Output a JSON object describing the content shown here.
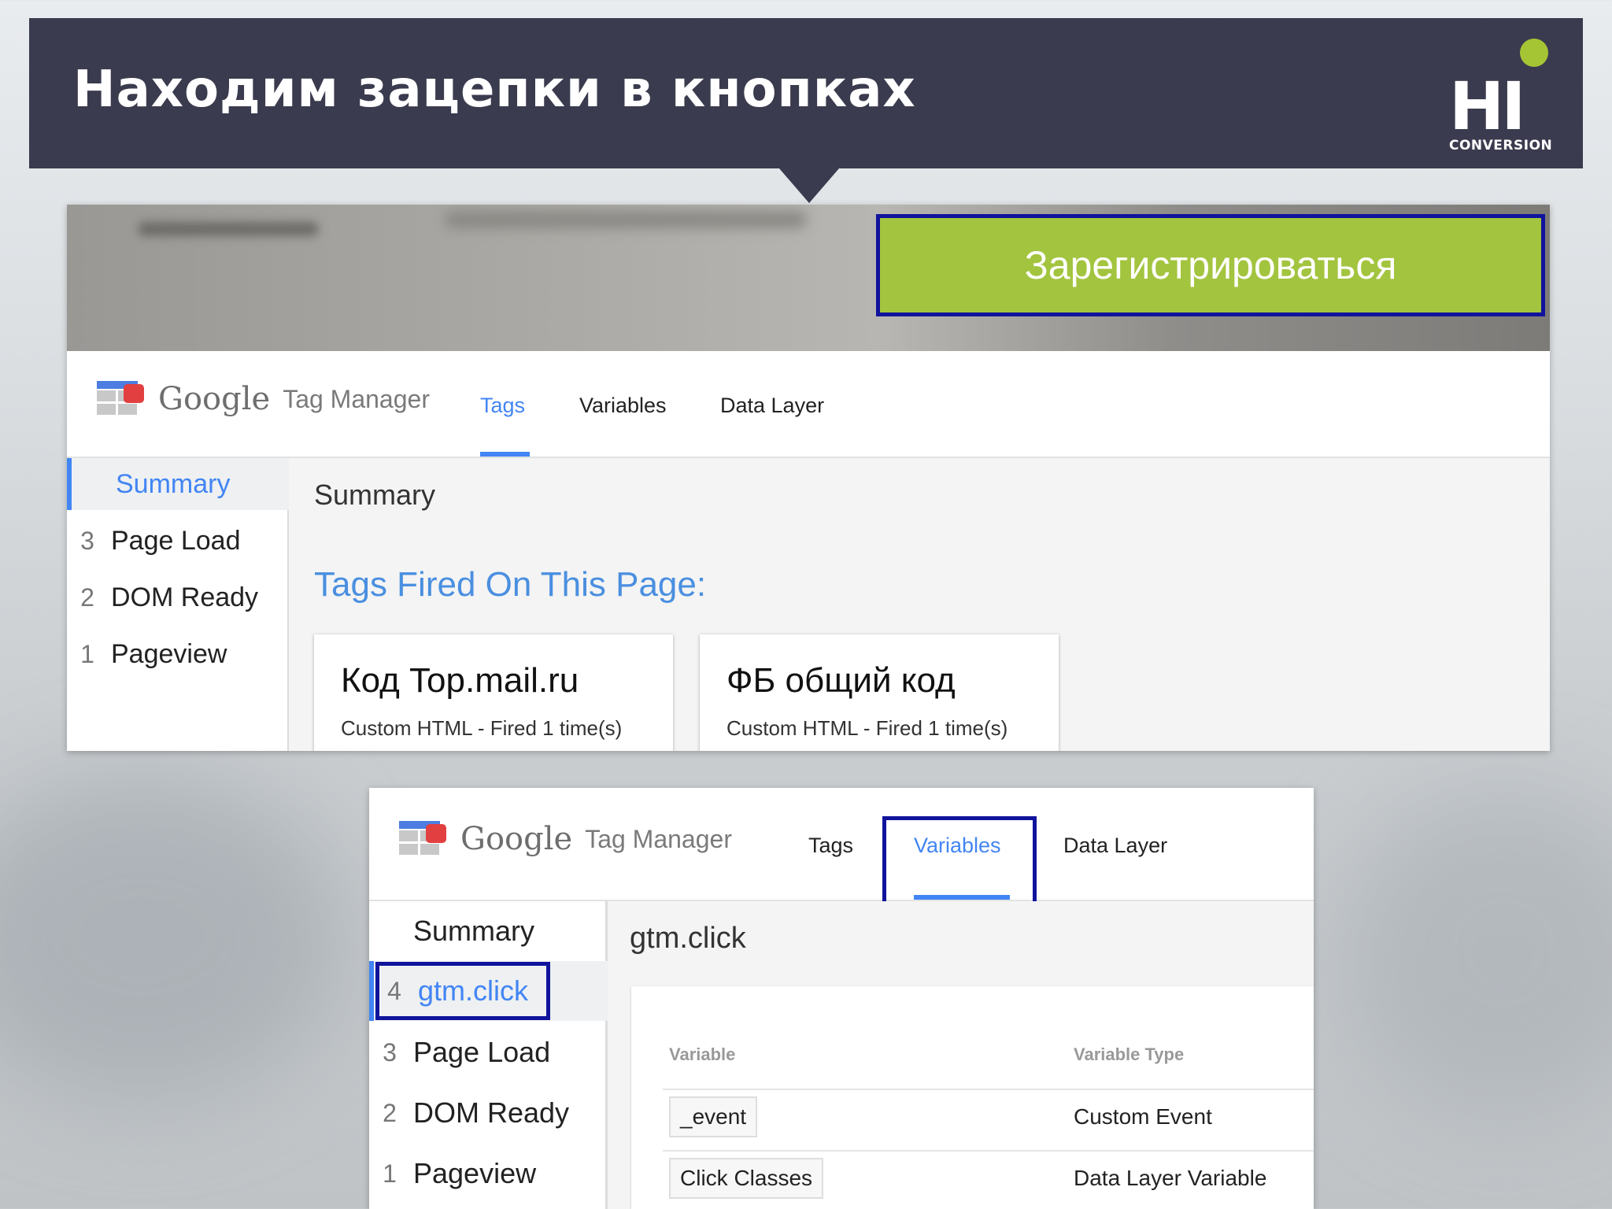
{
  "slide": {
    "title": "Находим зацепки в кнопках",
    "logo": {
      "main": "HI",
      "sub": "CONVERSION"
    }
  },
  "site": {
    "register_button": "Зарегистрироваться",
    "accent_color": "#a3c43f",
    "highlight_color": "#10139c"
  },
  "gtm_top": {
    "brand_google": "Google",
    "brand_tm": "Tag Manager",
    "tabs": [
      {
        "label": "Tags"
      },
      {
        "label": "Variables"
      },
      {
        "label": "Data Layer"
      }
    ],
    "active_tab": "Tags",
    "sidebar": [
      {
        "num": "",
        "label": "Summary"
      },
      {
        "num": "3",
        "label": "Page Load"
      },
      {
        "num": "2",
        "label": "DOM Ready"
      },
      {
        "num": "1",
        "label": "Pageview"
      }
    ],
    "heading": "Summary",
    "tags_fired_label": "Tags Fired On This Page:",
    "tags": [
      {
        "name": "Код Top.mail.ru",
        "detail": "Custom HTML - Fired 1 time(s)"
      },
      {
        "name": "ФБ общий код",
        "detail": "Custom HTML - Fired 1 time(s)"
      }
    ]
  },
  "gtm_bottom": {
    "brand_google": "Google",
    "brand_tm": "Tag Manager",
    "tabs": [
      {
        "label": "Tags"
      },
      {
        "label": "Variables"
      },
      {
        "label": "Data Layer"
      }
    ],
    "active_tab": "Variables",
    "sidebar": [
      {
        "num": "",
        "label": "Summary"
      },
      {
        "num": "4",
        "label": "gtm.click"
      },
      {
        "num": "3",
        "label": "Page Load"
      },
      {
        "num": "2",
        "label": "DOM Ready"
      },
      {
        "num": "1",
        "label": "Pageview"
      }
    ],
    "heading": "gtm.click",
    "table": {
      "headers": [
        "Variable",
        "Variable Type"
      ],
      "rows": [
        {
          "variable": "_event",
          "type": "Custom Event"
        },
        {
          "variable": "Click Classes",
          "type": "Data Layer Variable"
        }
      ]
    }
  }
}
